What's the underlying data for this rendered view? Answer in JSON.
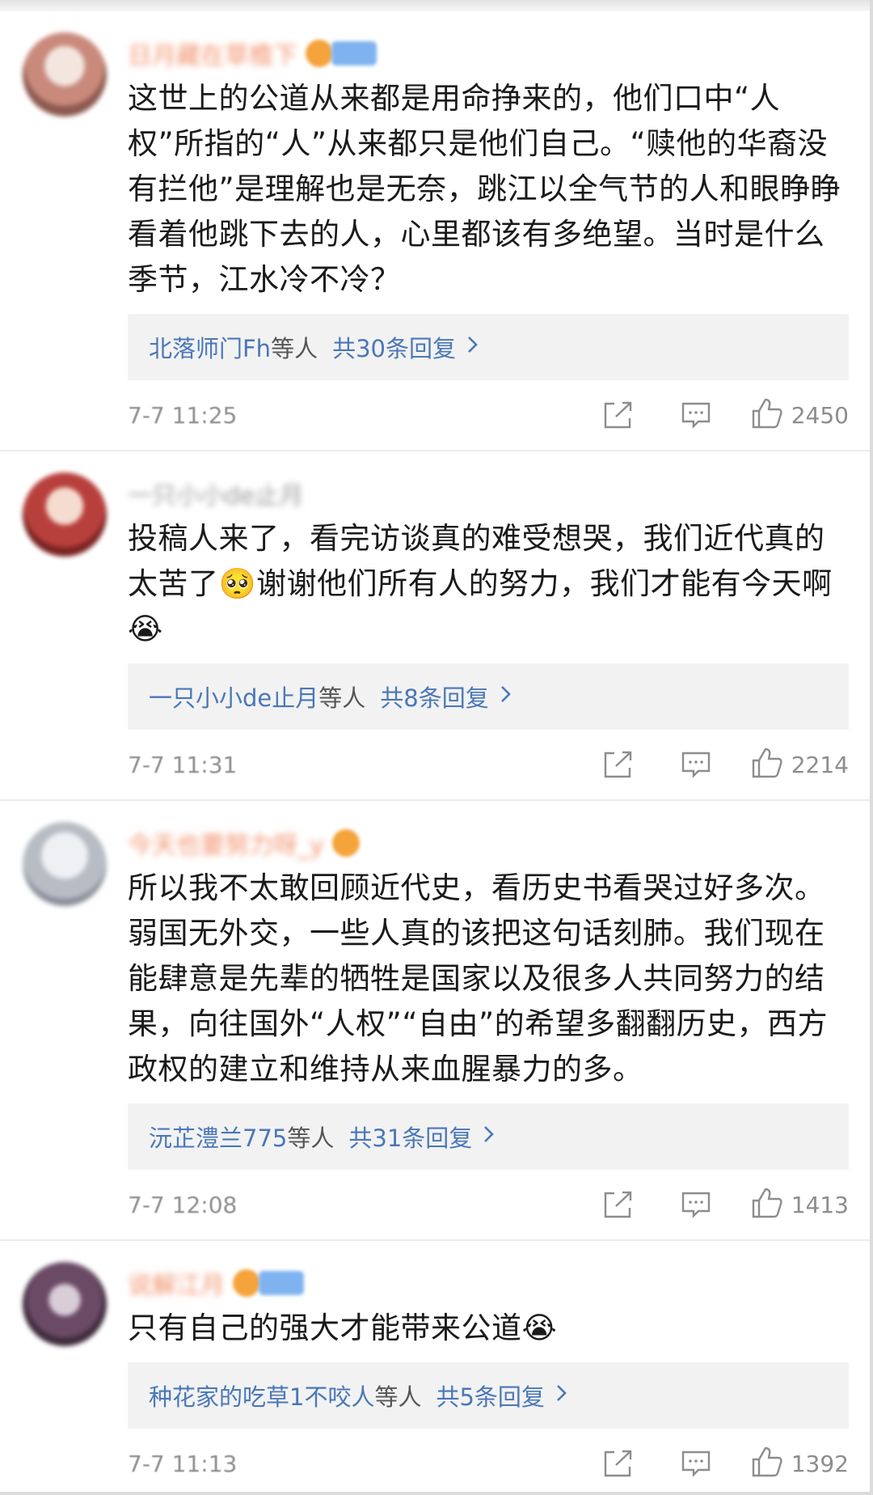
{
  "comments": [
    {
      "name": "日月藏在草檐下",
      "text": "这世上的公道从来都是用命挣来的，他们口中“人权”所指的“人”从来都只是他们自己。“赎他的华裔没有拦他”是理解也是无奈，跳江以全气节的人和眼睁睁看着他跳下去的人，心里都该有多绝望。当时是什么季节，江水冷不冷？",
      "reply_users": "北落师门Fh",
      "reply_etc": "等人",
      "reply_count": "共30条回复",
      "time": "7-7 11:25",
      "likes": "2450",
      "avatar_color": "#c98a7c"
    },
    {
      "name": "一只小小de止月",
      "text": "投稿人来了，看完访谈真的难受想哭，我们近代真的太苦了🥺谢谢他们所有人的努力，我们才能有今天啊😭",
      "reply_users": "一只小小de止月",
      "reply_etc": "等人",
      "reply_count": "共8条回复",
      "time": "7-7 11:31",
      "likes": "2214",
      "avatar_color": "#b8403c"
    },
    {
      "name": "今天也要努力呀_y",
      "text": "所以我不太敢回顾近代史，看历史书看哭过好多次。弱国无外交，一些人真的该把这句话刻肺。我们现在能肆意是先辈的牺牲是国家以及很多人共同努力的结果，向往国外“人权”“自由”的希望多翻翻历史，西方政权的建立和维持从来血腥暴力的多。",
      "reply_users": "沅芷澧兰775",
      "reply_etc": "等人",
      "reply_count": "共31条回复",
      "time": "7-7 12:08",
      "likes": "1413",
      "avatar_color": "#b7bcc5"
    },
    {
      "name": "说解江月",
      "text": "只有自己的强大才能带来公道😭",
      "reply_users": "种花家的吃草1不咬人",
      "reply_etc": "等人",
      "reply_count": "共5条回复",
      "time": "7-7 11:13",
      "likes": "1392",
      "avatar_color": "#6b4a66"
    }
  ],
  "icons": {
    "share": "share-icon",
    "reply": "comment-icon",
    "like": "thumbs-up-icon",
    "chevron": "chevron-right-icon"
  },
  "colors": {
    "link": "#4a77b8",
    "name": "#f2906a",
    "meta": "#8d8d8d",
    "reply_bg": "#f2f2f2"
  }
}
